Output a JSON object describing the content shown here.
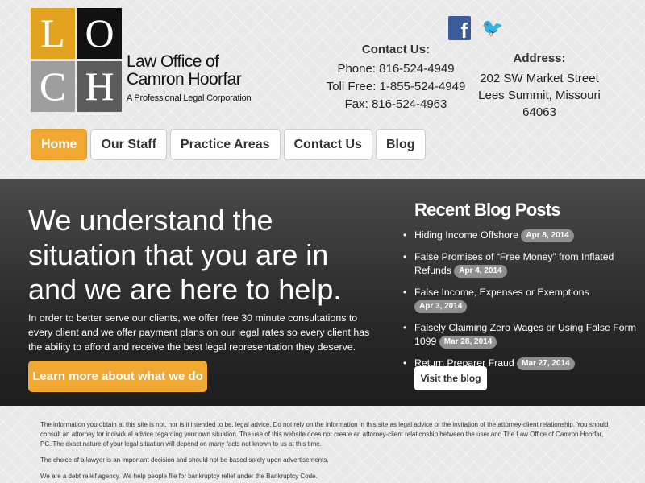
{
  "logo": {
    "letters": [
      "L",
      "O",
      "C",
      "H"
    ]
  },
  "firm": {
    "line1": "Law Office of",
    "line2": "Camron Hoorfar",
    "tagline": "A Professional Legal Corporation"
  },
  "social": {
    "facebook_icon": "facebook-icon",
    "twitter_icon": "twitter-icon",
    "facebook_glyph": "f",
    "twitter_glyph": "🐦"
  },
  "contact": {
    "heading": "Contact Us:",
    "phone": "Phone: 816-524-4949",
    "tollfree": "Toll Free: 1-855-524-4949",
    "fax": "Fax: 816-524-4963"
  },
  "address": {
    "heading": "Address:",
    "street": "202 SW Market Street",
    "city": "Lees Summit, Missouri 64063"
  },
  "nav": {
    "items": [
      {
        "label": "Home",
        "active": true
      },
      {
        "label": "Our Staff"
      },
      {
        "label": "Practice Areas"
      },
      {
        "label": "Contact Us"
      },
      {
        "label": "Blog"
      }
    ]
  },
  "hero": {
    "headline": "We understand the situation that you are in and we are here to help.",
    "body": "In order to better serve our clients, we offer free 30 minute consultations to every client and we offer payment plans on our legal rates so every client has the ability to afford and receive the best legal representation they deserve.",
    "cta": "Learn more about what we do"
  },
  "blog": {
    "heading": "Recent Blog Posts",
    "posts": [
      {
        "title": "Hiding Income Offshore",
        "date": "Apr 8, 2014"
      },
      {
        "title": "False Promises of “Free Money” from Inflated Refunds",
        "date": "Apr 4, 2014"
      },
      {
        "title": "False Income, Expenses or Exemptions",
        "date": "Apr 3, 2014"
      },
      {
        "title": "Falsely Claiming Zero Wages or Using False Form 1099",
        "date": "Mar 28, 2014"
      },
      {
        "title": "Return Preparer Fraud",
        "date": "Mar 27, 2014"
      }
    ],
    "visit": "Visit the blog"
  },
  "footer": {
    "p1": "The information you obtain at this site is not, nor is it intended to be, legal advice. Do not rely on the information in this site as legal advice or the invitation of the attorney-client relationship. You should consult an attorney for individual advice regarding your own situation. The use of this website does not create an attorney-client relationship between the user and The Law Office of Camron Hoorfar, PC. The exact nature of your legal situation will depend on many facts not known to us at this time.",
    "p2": "The choice of a lawyer is an important decision and should not be based solely upon advertisements.",
    "p3": "We are a debt relief agency. We help people file for bankruptcy relief under the Bankruptcy Code."
  },
  "colors": {
    "accent": "#f0a832",
    "logo_gold": "#e3a21e",
    "hero_bg": "#2a2a2a"
  }
}
